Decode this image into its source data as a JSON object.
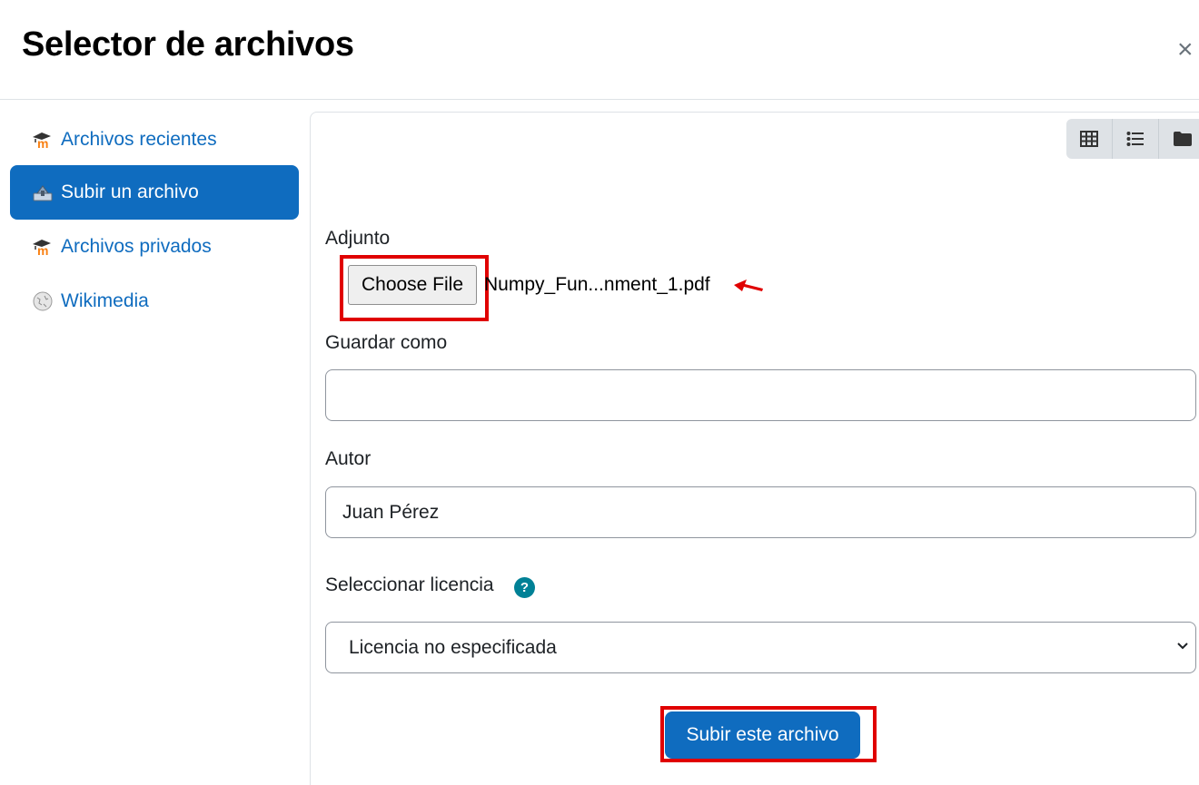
{
  "dialog": {
    "title": "Selector de archivos",
    "close_label": "×"
  },
  "sidebar": {
    "items": [
      {
        "label": "Archivos recientes",
        "icon": "moodle-icon",
        "active": false
      },
      {
        "label": "Subir un archivo",
        "icon": "upload-icon",
        "active": true
      },
      {
        "label": "Archivos privados",
        "icon": "moodle-icon",
        "active": false
      },
      {
        "label": "Wikimedia",
        "icon": "wikipedia-icon",
        "active": false
      }
    ]
  },
  "view_buttons": [
    "grid-view-icon",
    "list-view-icon",
    "folder-view-icon"
  ],
  "form": {
    "attachment_label": "Adjunto",
    "choose_file_label": "Choose File",
    "file_name": "Numpy_Fun...nment_1.pdf",
    "save_as_label": "Guardar como",
    "save_as_value": "",
    "author_label": "Autor",
    "author_value": "Juan Pérez",
    "license_label": "Seleccionar licencia",
    "license_help": "?",
    "license_value": "Licencia no especificada",
    "submit_label": "Subir este archivo"
  },
  "colors": {
    "primary": "#0f6cbf",
    "highlight": "#e00000",
    "help": "#008196"
  }
}
